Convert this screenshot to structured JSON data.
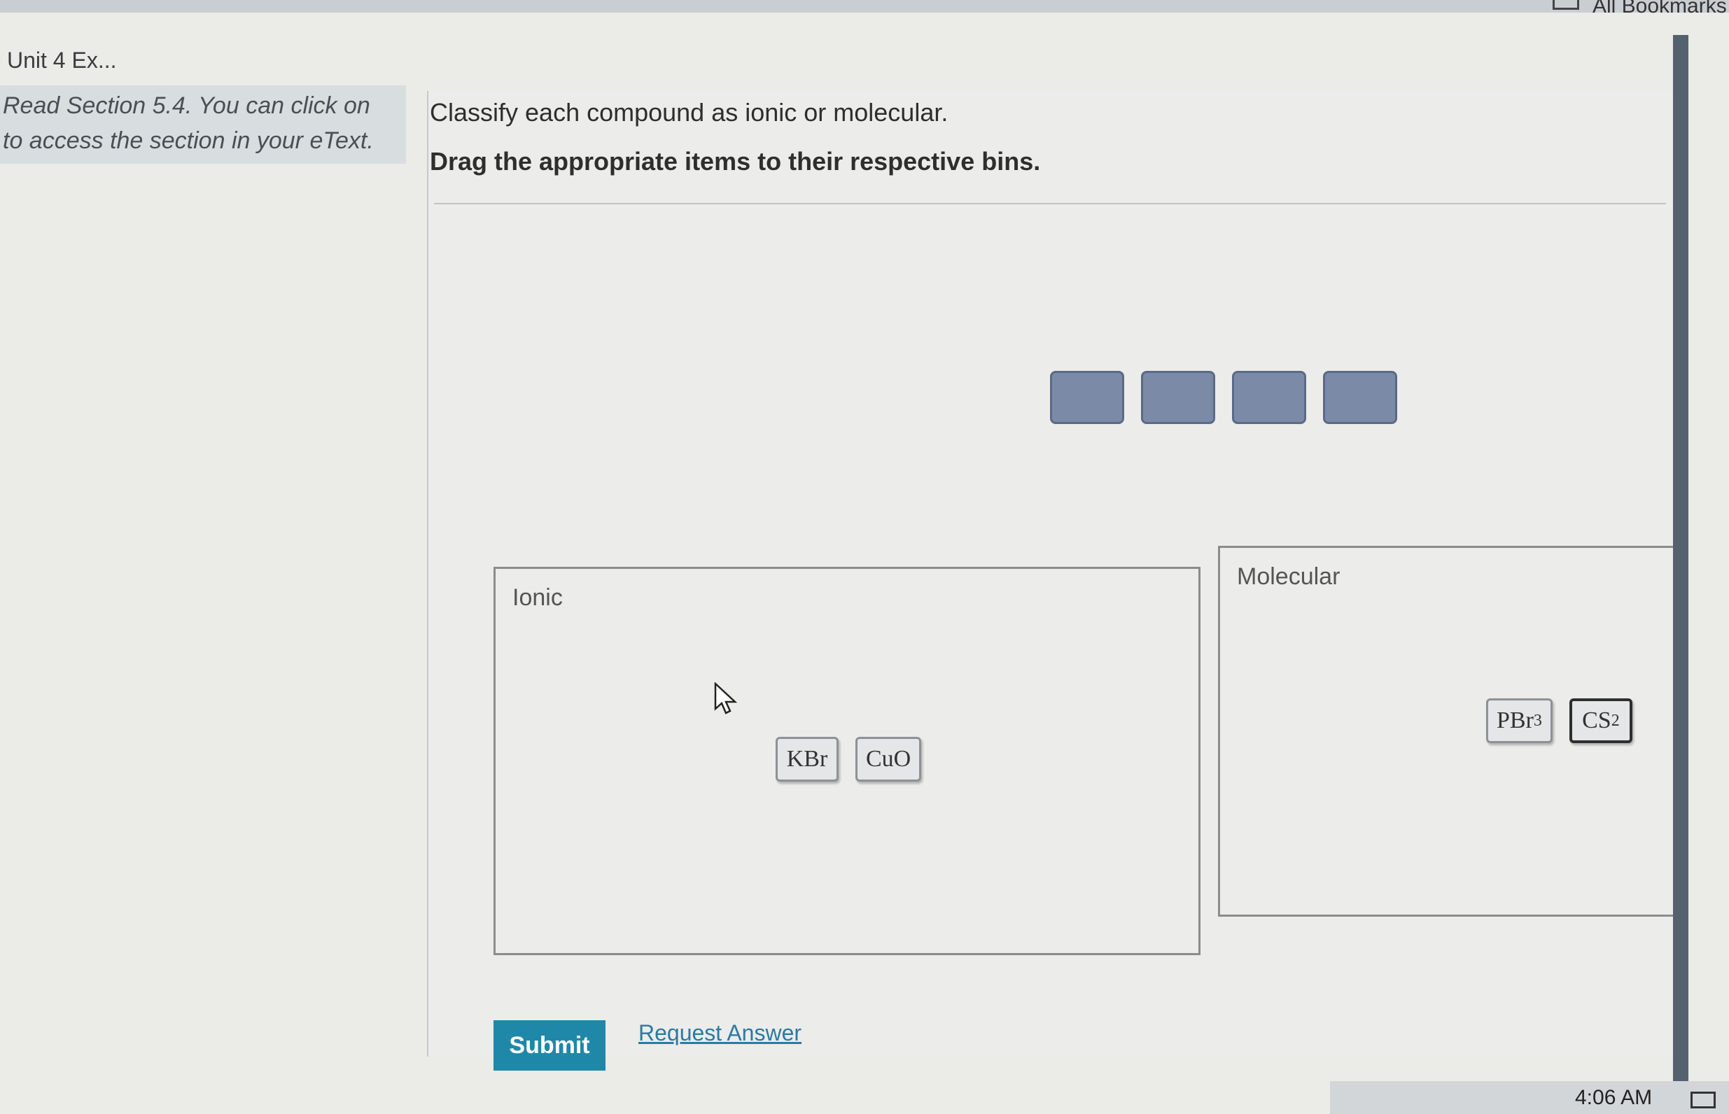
{
  "browser": {
    "tab_title": "Unit 4 Ex...",
    "bookmarks_label": "All Bookmarks"
  },
  "hint": {
    "text": "Read Section 5.4. You can click on to access the section in your eText."
  },
  "question": {
    "instruction": "Classify each compound as ionic or molecular.",
    "drag_instruction": "Drag the appropriate items to their respective bins."
  },
  "item_pool": {
    "empty_slot_count": 4
  },
  "bins": {
    "ionic": {
      "label": "Ionic",
      "items": [
        "KBr",
        "CuO"
      ]
    },
    "molecular": {
      "label": "Molecular",
      "items": [
        "PBr3",
        "CS2"
      ]
    }
  },
  "actions": {
    "submit_label": "Submit",
    "request_answer_label": "Request Answer"
  },
  "taskbar": {
    "clock": "4:06 AM"
  },
  "colors": {
    "submit_bg": "#1f88a8",
    "link": "#2c7aa3",
    "empty_slot": "#7b8aa6"
  }
}
